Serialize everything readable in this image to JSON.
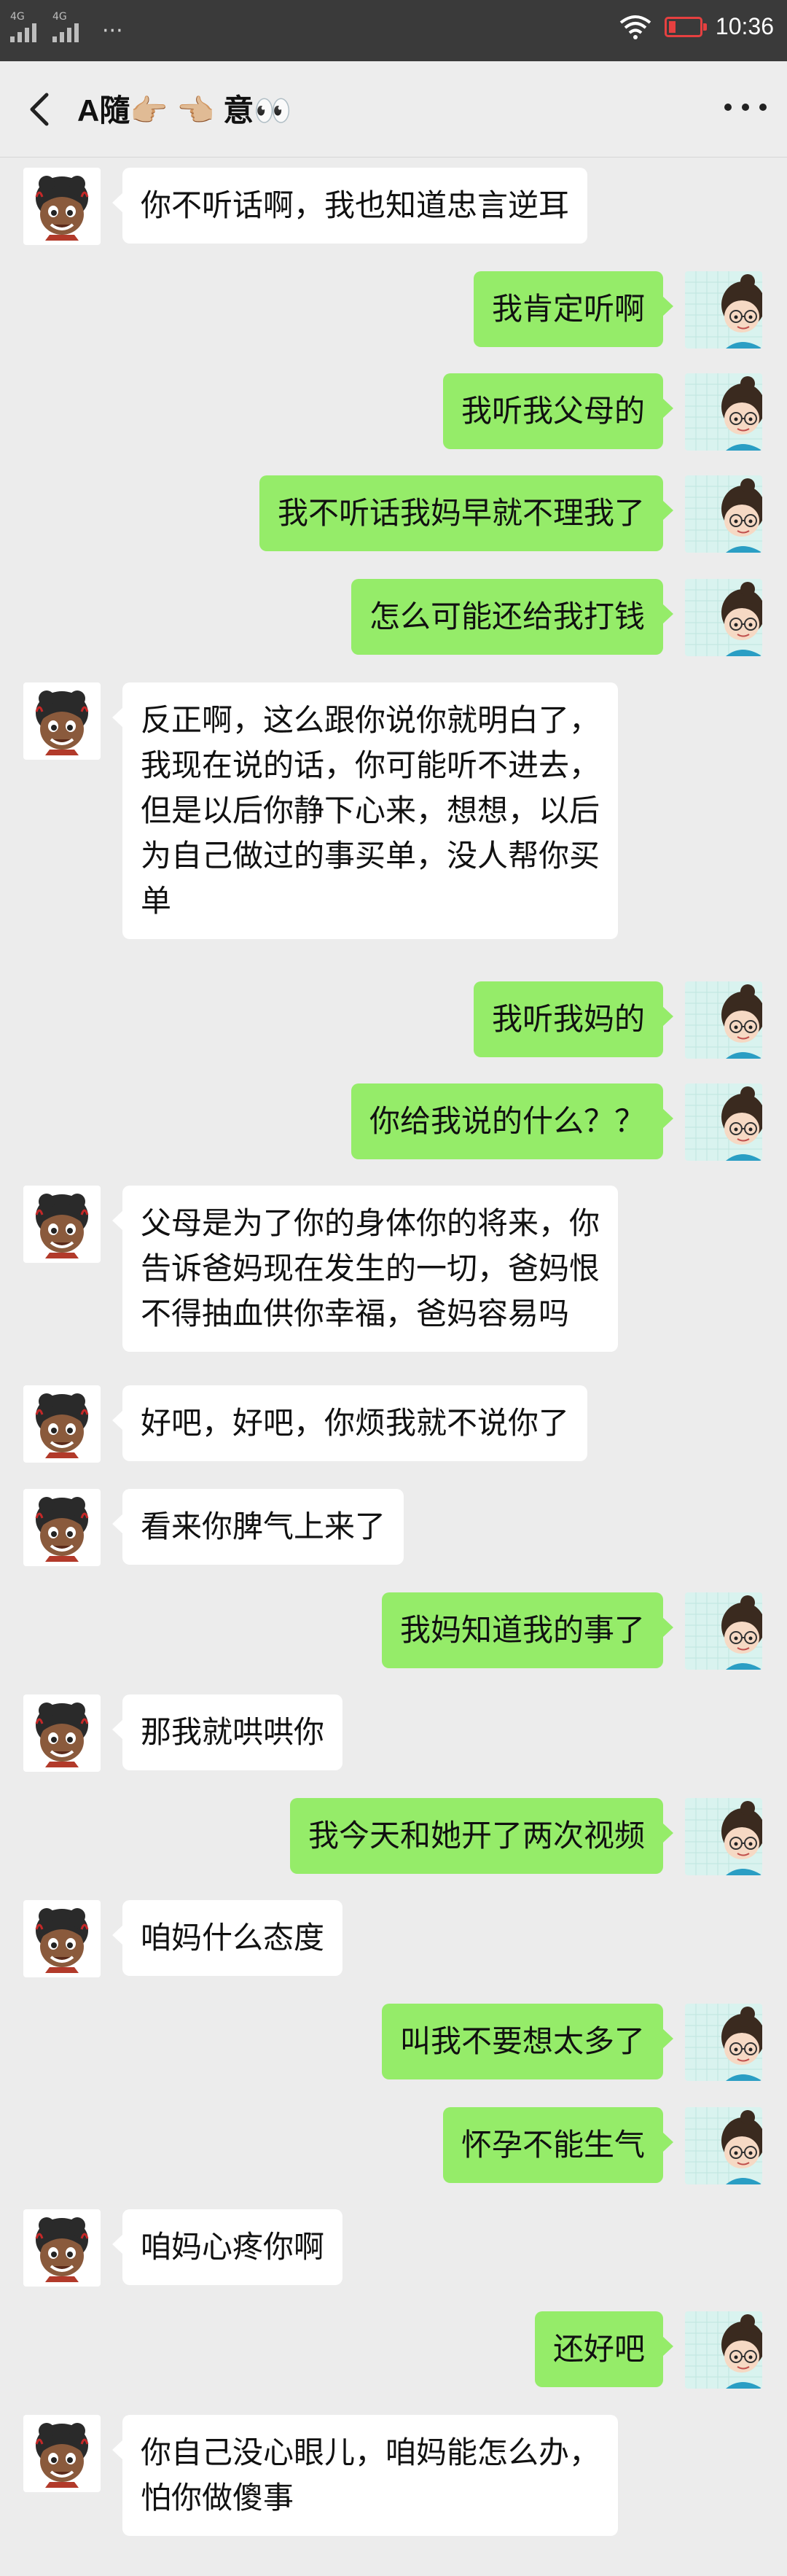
{
  "status_bar": {
    "signal_tags": [
      "4G",
      "4G"
    ],
    "time": "10:36",
    "icons": [
      "signal-icon",
      "wifi-icon",
      "battery-low-icon"
    ],
    "battery_color": "#e64040"
  },
  "header": {
    "title_prefix": "A隨",
    "title_emoji_1": "👉🏼",
    "title_emoji_2": "👈🏼",
    "title_suffix": "意",
    "title_emoji_3": "👀",
    "back_icon": "chevron-left-icon",
    "more_icon": "more-dots-icon"
  },
  "colors": {
    "sent_bubble": "#95ec69",
    "received_bubble": "#ffffff",
    "background": "#ececec"
  },
  "messages": [
    {
      "side": "left",
      "text": "你不听话啊，我也知道忠言逆耳"
    },
    {
      "side": "right",
      "text": "我肯定听啊"
    },
    {
      "side": "right",
      "text": "我听我父母的"
    },
    {
      "side": "right",
      "text": "我不听话我妈早就不理我了"
    },
    {
      "side": "right",
      "text": "怎么可能还给我打钱"
    },
    {
      "side": "left",
      "text": "反正啊，这么跟你说你就明白了，\n我现在说的话，你可能听不进去，\n但是以后你静下心来，想想，以后\n为自己做过的事买单，没人帮你买\n单"
    },
    {
      "side": "right",
      "text": "我听我妈的"
    },
    {
      "side": "right",
      "text": "你给我说的什么？？"
    },
    {
      "side": "left",
      "text": "父母是为了你的身体你的将来，你\n告诉爸妈现在发生的一切，爸妈恨\n不得抽血供你幸福，爸妈容易吗"
    },
    {
      "side": "left",
      "text": "好吧，好吧，你烦我就不说你了"
    },
    {
      "side": "left",
      "text": "看来你脾气上来了"
    },
    {
      "side": "right",
      "text": "我妈知道我的事了"
    },
    {
      "side": "left",
      "text": "那我就哄哄你"
    },
    {
      "side": "right",
      "text": "我今天和她开了两次视频"
    },
    {
      "side": "left",
      "text": "咱妈什么态度"
    },
    {
      "side": "right",
      "text": "叫我不要想太多了"
    },
    {
      "side": "right",
      "text": "怀孕不能生气"
    },
    {
      "side": "left",
      "text": "咱妈心疼你啊"
    },
    {
      "side": "right",
      "text": "还好吧"
    },
    {
      "side": "left",
      "text": "你自己没心眼儿，咱妈能怎么办，\n怕你做傻事"
    }
  ]
}
